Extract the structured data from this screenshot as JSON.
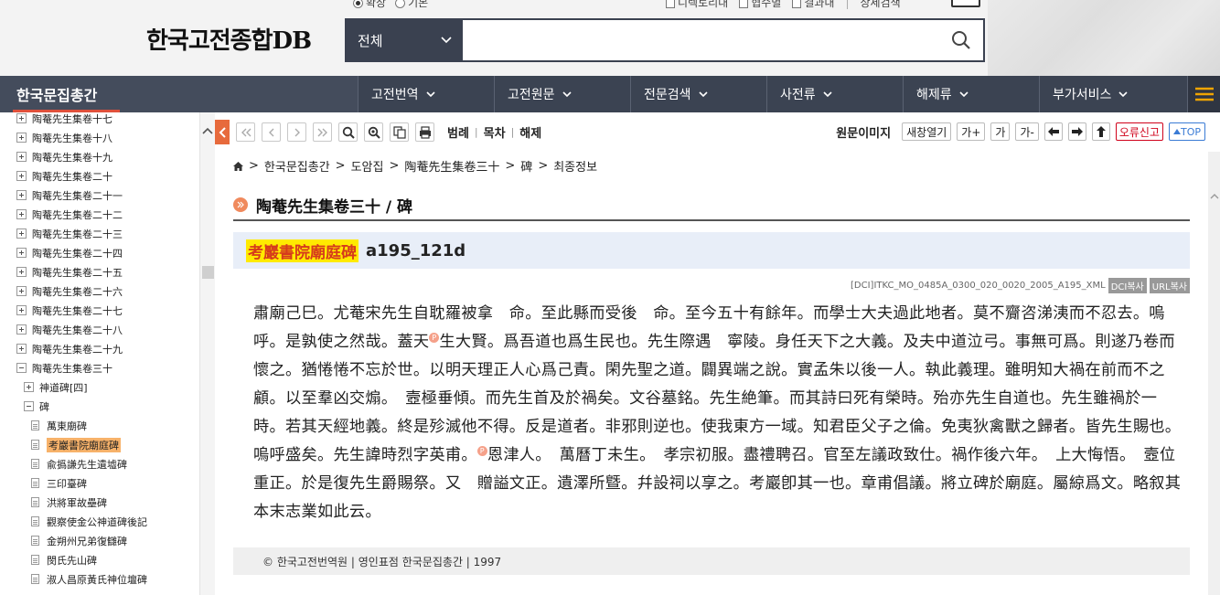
{
  "header": {
    "logo": "한국고전종합DB",
    "radio_options": [
      {
        "label": "확장",
        "checked": true
      },
      {
        "label": "기본",
        "checked": false
      }
    ],
    "check_options": [
      "디렉토리내",
      "협수별",
      "결과내"
    ],
    "detail_search": "상세검색",
    "search": {
      "scope": "전체",
      "value": "",
      "placeholder": ""
    }
  },
  "nav": {
    "brand": "한국문집총간",
    "items": [
      "고전번역",
      "고전원문",
      "전문검색",
      "사전류",
      "해제류",
      "부가서비스"
    ]
  },
  "sidebar": {
    "items": [
      {
        "label": "陶菴先生集卷十七",
        "type": "plus"
      },
      {
        "label": "陶菴先生集卷十八",
        "type": "plus"
      },
      {
        "label": "陶菴先生集卷十九",
        "type": "plus"
      },
      {
        "label": "陶菴先生集卷二十",
        "type": "plus"
      },
      {
        "label": "陶菴先生集卷二十一",
        "type": "plus"
      },
      {
        "label": "陶菴先生集卷二十二",
        "type": "plus"
      },
      {
        "label": "陶菴先生集卷二十三",
        "type": "plus"
      },
      {
        "label": "陶菴先生集卷二十四",
        "type": "plus"
      },
      {
        "label": "陶菴先生集卷二十五",
        "type": "plus"
      },
      {
        "label": "陶菴先生集卷二十六",
        "type": "plus"
      },
      {
        "label": "陶菴先生集卷二十七",
        "type": "plus"
      },
      {
        "label": "陶菴先生集卷二十八",
        "type": "plus"
      },
      {
        "label": "陶菴先生集卷二十九",
        "type": "plus"
      },
      {
        "label": "陶菴先生集卷三十",
        "type": "minus"
      },
      {
        "label": "神道碑[四]",
        "type": "plus",
        "level": 1
      },
      {
        "label": "碑",
        "type": "minus",
        "level": 1
      },
      {
        "label": "萬東廟碑",
        "type": "doc",
        "level": 2
      },
      {
        "label": "考巖書院廟庭碑",
        "type": "doc",
        "level": 2,
        "selected": true
      },
      {
        "label": "兪撝謙先生遺墟碑",
        "type": "doc",
        "level": 2
      },
      {
        "label": "三印臺碑",
        "type": "doc",
        "level": 2
      },
      {
        "label": "洪將軍故壘碑",
        "type": "doc",
        "level": 2
      },
      {
        "label": "觀察使金公神道碑後記",
        "type": "doc",
        "level": 2
      },
      {
        "label": "金朔州兄弟復讎碑",
        "type": "doc",
        "level": 2
      },
      {
        "label": "閔氏先山碑",
        "type": "doc",
        "level": 2
      },
      {
        "label": "淑人昌原黃氏神位壇碑",
        "type": "doc",
        "level": 2
      }
    ]
  },
  "toolbar": {
    "links": [
      "범례",
      "목차",
      "해제"
    ],
    "original_image": "원문이미지",
    "new_window": "새창열기",
    "font_up": "가+",
    "font_normal": "가",
    "font_down": "가-",
    "report": "오류신고",
    "top": "TOP"
  },
  "breadcrumb": [
    "한국문집총간",
    "도암집",
    "陶菴先生集卷三十",
    "碑",
    "최종정보"
  ],
  "document": {
    "title": "陶菴先生集卷三十 / 碑",
    "item_title": "考巖書院廟庭碑",
    "item_code": "a195_121d",
    "citation": "[DCI]ITKC_MO_0485A_0300_020_0020_2005_A195_XML",
    "dci_copy": "DCI복사",
    "url_copy": "URL복사",
    "p_mark": "P",
    "body_parts": [
      "肅廟己巳。尤菴宋先生自耽羅被拿　命。至此縣而受後　命。至今五十有餘年。而學士大夫過此地者。莫不齎咨涕洟而不忍去。嗚呼。是孰使之然哉。蓋天",
      "生大賢。爲吾道也爲生民也。先生際遇　寧陵。身任天下之大義。及夫中道泣弓。事無可爲。則遂乃卷而懷之。猶惓惓不忘於世。以明天理正人心爲己責。閑先聖之道。闢異端之說。實孟朱以後一人。執此義理。雖明知大禍在前而不之顧。以至羣凶交煽。　壼極垂傾。而先生首及於禍矣。文谷墓銘。先生絶筆。而其詩曰死有榮時。殆亦先生自道也。先生雖禍於一時。若其天經地義。終是殄滅他不得。反是道者。非邪則逆也。使我東方一域。知君臣父子之倫。免夷狄禽獸之歸者。皆先生賜也。嗚呼盛矣。先生諱時烈字英甫。",
      "恩津人。　萬曆丁未生。　孝宗初服。盡禮聘召。官至左議政致仕。禍作後六年。　上大悔悟。　壼位重正。於是復先生爵賜祭。又　贈謚文正。遺澤所曁。幷設祠以享之。考巖卽其一也。章甫倡議。將立碑於廟庭。屬綡爲文。略叙其本末志業如此云。"
    ],
    "footer": "© 한국고전번역원 | 영인표점 한국문집총간 | 1997"
  }
}
